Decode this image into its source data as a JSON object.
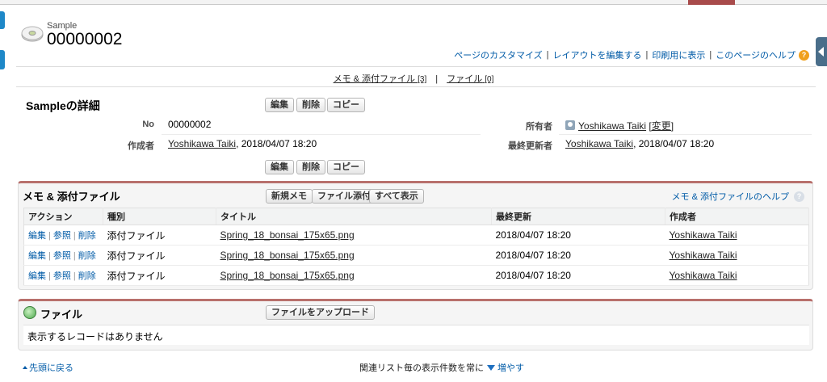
{
  "header": {
    "object_label": "Sample",
    "record_name": "00000002",
    "links": [
      "ページのカスタマイズ",
      "レイアウトを編集する",
      "印刷用に表示",
      "このページのヘルプ"
    ],
    "help_icon": "?"
  },
  "related_links": {
    "notes_label": "メモ & 添付ファイル",
    "notes_count": "[3]",
    "separator": "|",
    "files_label": "ファイル",
    "files_count": "[0]"
  },
  "detail": {
    "title": "Sampleの詳細",
    "buttons": {
      "edit": "編集",
      "delete": "削除",
      "copy": "コピー"
    },
    "fields": {
      "no_label": "No",
      "no_value": "00000002",
      "owner_label": "所有者",
      "owner_value": "Yoshikawa Taiki",
      "owner_change": "[変更]",
      "created_label": "作成者",
      "created_user": "Yoshikawa Taiki",
      "created_date": ", 2018/04/07 18:20",
      "modified_label": "最終更新者",
      "modified_user": "Yoshikawa Taiki",
      "modified_date": ", 2018/04/07 18:20"
    }
  },
  "notes_panel": {
    "title": "メモ & 添付ファイル",
    "buttons": {
      "new_note": "新規メモ",
      "attach_file": "ファイル添付",
      "show_all": "すべて表示"
    },
    "help_link": "メモ & 添付ファイルのヘルプ",
    "help_icon": "?",
    "columns": [
      "アクション",
      "種別",
      "タイトル",
      "最終更新",
      "作成者"
    ],
    "action_labels": {
      "edit": "編集",
      "view": "参照",
      "delete": "削除"
    },
    "rows": [
      {
        "type": "添付ファイル",
        "title": "Spring_18_bonsai_175x65.png",
        "modified": "2018/04/07 18:20",
        "creator": "Yoshikawa Taiki"
      },
      {
        "type": "添付ファイル",
        "title": "Spring_18_bonsai_175x65.png",
        "modified": "2018/04/07 18:20",
        "creator": "Yoshikawa Taiki"
      },
      {
        "type": "添付ファイル",
        "title": "Spring_18_bonsai_175x65.png",
        "modified": "2018/04/07 18:20",
        "creator": "Yoshikawa Taiki"
      }
    ]
  },
  "files_panel": {
    "title": "ファイル",
    "upload_button": "ファイルをアップロード",
    "empty_message": "表示するレコードはありません"
  },
  "footer": {
    "back_to_top": "先頭に戻る",
    "show_more_text": "関連リスト毎の表示件数を常に",
    "show_more_link": "増やす"
  },
  "colors": {
    "link": "#015ba7",
    "panel_accent": "#b8706c",
    "help_icon": "#f0a01b",
    "left_tab": "#1e88c8"
  }
}
